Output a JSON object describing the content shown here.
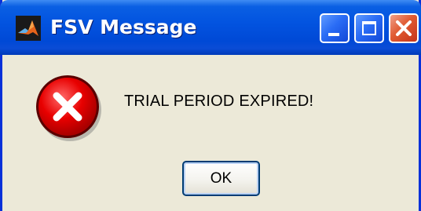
{
  "window": {
    "title": "FSV Message",
    "controls": {
      "minimize": "minimize",
      "maximize": "maximize",
      "close": "close"
    }
  },
  "dialog": {
    "icon": "error-icon",
    "message": "TRIAL PERIOD EXPIRED!",
    "ok_label": "OK"
  },
  "colors": {
    "titlebar": "#0054e3",
    "window_bg": "#ece9d8",
    "error_red": "#e00000",
    "close_button": "#e05a32"
  }
}
